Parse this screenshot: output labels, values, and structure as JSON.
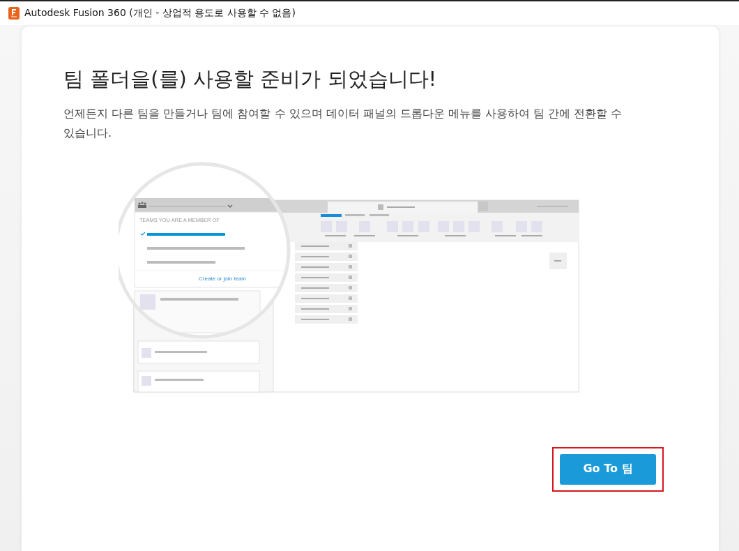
{
  "window": {
    "title": "Autodesk Fusion 360 (개인 - 상업적 용도로 사용할 수 없음)"
  },
  "dialog": {
    "heading": "팀 폴더을(를) 사용할 준비가 되었습니다!",
    "description": "언제든지 다른 팀을 만들거나 팀에 참여할 수 있으며 데이터 패널의 드롭다운 메뉴를 사용하여 팀 간에 전환할 수 있습니다.",
    "illustration": {
      "section_label": "TEAMS YOU ARE A MEMBER OF",
      "teams": [
        {
          "selected": true
        },
        {
          "selected": false
        },
        {
          "selected": false
        }
      ],
      "link": "Create or join team"
    },
    "primary_button": {
      "label": "Go To 팀",
      "highlighted": true
    }
  }
}
